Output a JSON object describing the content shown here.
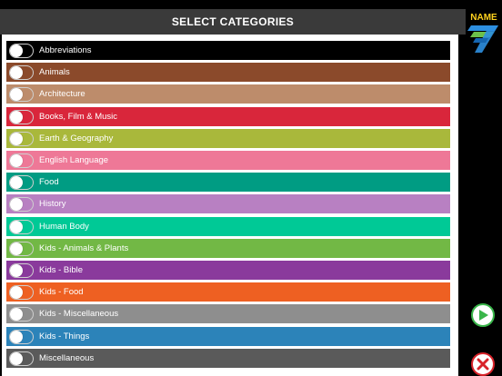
{
  "header": {
    "title": "SELECT CATEGORIES"
  },
  "logo": {
    "text": "NAME",
    "number": "7"
  },
  "categories": [
    {
      "label": "Abbreviations",
      "color": "#000000"
    },
    {
      "label": "Animals",
      "color": "#8b4a2b"
    },
    {
      "label": "Architecture",
      "color": "#bd8c6b"
    },
    {
      "label": "Books, Film & Music",
      "color": "#d9263b"
    },
    {
      "label": "Earth & Geography",
      "color": "#a9b83b"
    },
    {
      "label": "English Language",
      "color": "#ee7897"
    },
    {
      "label": "Food",
      "color": "#009c83"
    },
    {
      "label": "History",
      "color": "#b880c2"
    },
    {
      "label": "Human Body",
      "color": "#00c996"
    },
    {
      "label": "Kids - Animals & Plants",
      "color": "#72b845"
    },
    {
      "label": "Kids - Bible",
      "color": "#8a3a9c"
    },
    {
      "label": "Kids - Food",
      "color": "#ee6022"
    },
    {
      "label": "Kids - Miscellaneous",
      "color": "#8e8e8e"
    },
    {
      "label": "Kids - Things",
      "color": "#2c83b9"
    },
    {
      "label": "Miscellaneous",
      "color": "#5a5a5a"
    }
  ],
  "actions": {
    "play_icon": "play-icon",
    "close_icon": "close-icon"
  }
}
